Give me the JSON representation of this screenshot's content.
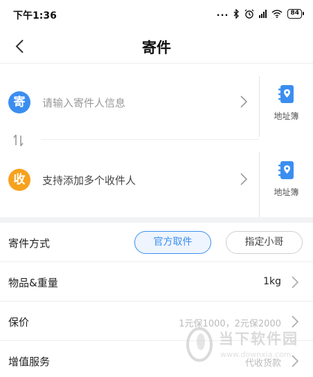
{
  "status_bar": {
    "time": "下午1:36",
    "dots": "...",
    "battery": "84"
  },
  "header": {
    "title": "寄件"
  },
  "sender": {
    "badge": "寄",
    "placeholder": "请输入寄件人信息",
    "address_book_label": "地址簿"
  },
  "receiver": {
    "badge": "收",
    "text": "支持添加多个收件人",
    "address_book_label": "地址簿"
  },
  "options": {
    "method_label": "寄件方式",
    "method_options": [
      "官方取件",
      "指定小哥"
    ],
    "method_selected": "官方取件",
    "items_label": "物品&重量",
    "items_value": "1kg",
    "insurance_label": "保价",
    "insurance_value": "1元保1000，2元保2000",
    "service_label": "增值服务",
    "service_value": "代收货款"
  },
  "watermark": {
    "text": "当下软件园",
    "url": "www.downxia.com"
  },
  "colors": {
    "accent": "#3b8ef0",
    "sender_badge": "#3b8ef0",
    "receiver_badge": "#f6a21d",
    "divider": "#eeeeee",
    "section_gap": "#f2f3f5"
  }
}
